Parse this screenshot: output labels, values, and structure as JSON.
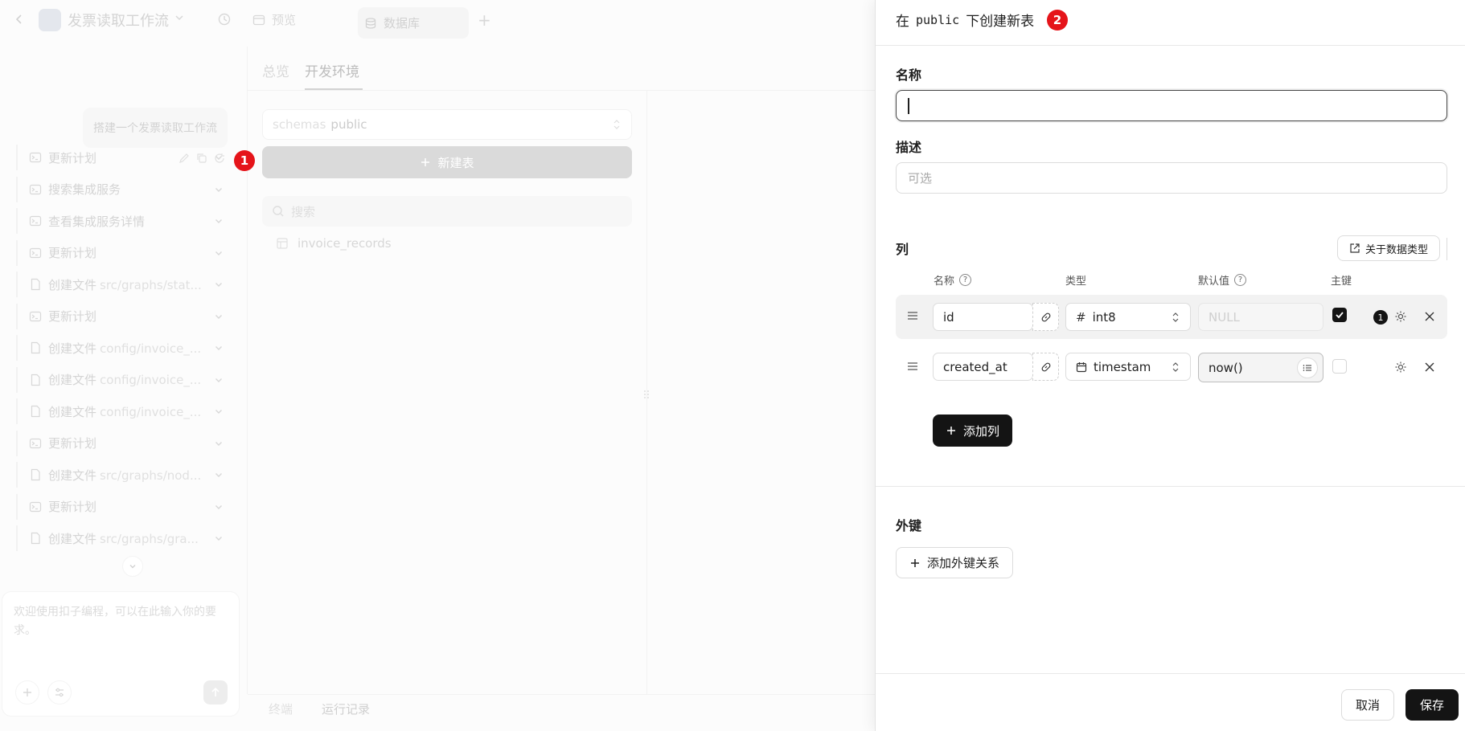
{
  "topbar": {
    "project_title": "发票读取工作流",
    "tab_preview": "预览",
    "tab_database": "数据库",
    "add_tab": "+"
  },
  "chat": {
    "user_message": "搭建一个发票读取工作流",
    "items": [
      {
        "label": "更新计划",
        "path": "",
        "icon": "terminal-icon"
      },
      {
        "label": "搜索集成服务",
        "path": "",
        "icon": "terminal-icon"
      },
      {
        "label": "查看集成服务详情",
        "path": "",
        "icon": "terminal-icon"
      },
      {
        "label": "更新计划",
        "path": "",
        "icon": "terminal-icon"
      },
      {
        "label": "创建文件",
        "path": "src/graphs/stat...",
        "icon": "file-icon"
      },
      {
        "label": "更新计划",
        "path": "",
        "icon": "terminal-icon"
      },
      {
        "label": "创建文件",
        "path": "config/invoice_...",
        "icon": "file-icon"
      },
      {
        "label": "创建文件",
        "path": "config/invoice_...",
        "icon": "file-icon"
      },
      {
        "label": "创建文件",
        "path": "config/invoice_...",
        "icon": "file-icon"
      },
      {
        "label": "更新计划",
        "path": "",
        "icon": "terminal-icon"
      },
      {
        "label": "创建文件",
        "path": "src/graphs/nod...",
        "icon": "file-icon"
      },
      {
        "label": "更新计划",
        "path": "",
        "icon": "terminal-icon"
      },
      {
        "label": "创建文件",
        "path": "src/graphs/gra...",
        "icon": "file-icon"
      }
    ],
    "input_placeholder": "欢迎使用扣子编程，可以在此输入你的要求。"
  },
  "db": {
    "tab_overview": "总览",
    "tab_dev": "开发环境",
    "schema_prefix": "schemas",
    "schema_value": "public",
    "new_table_label": "新建表",
    "search_placeholder": "搜索",
    "tables": [
      "invoice_records"
    ],
    "bottom_tab_terminal": "终端",
    "bottom_tab_runs": "运行记录"
  },
  "annotations": {
    "step1": "1",
    "step2": "2"
  },
  "drawer": {
    "title_prefix": "在",
    "title_schema": "public",
    "title_suffix": "下创建新表",
    "name_label": "名称",
    "name_value": "",
    "desc_label": "描述",
    "desc_placeholder": "可选",
    "columns_label": "列",
    "about_types_label": "关于数据类型",
    "col_header_name": "名称",
    "col_header_type": "类型",
    "col_header_default": "默认值",
    "col_header_pk": "主键",
    "columns": [
      {
        "name": "id",
        "type": "int8",
        "type_icon": "hash-icon",
        "default_value": "",
        "default_placeholder": "NULL",
        "primary_key": true,
        "badge": "1"
      },
      {
        "name": "created_at",
        "type": "timestam",
        "type_icon": "calendar-icon",
        "default_value": "now()",
        "default_placeholder": "",
        "primary_key": false,
        "badge": ""
      }
    ],
    "add_column_label": "添加列",
    "fk_label": "外键",
    "add_fk_label": "添加外键关系",
    "cancel_label": "取消",
    "save_label": "保存"
  },
  "colors": {
    "accent_red": "#e5141a",
    "dark_button": "#141414"
  }
}
